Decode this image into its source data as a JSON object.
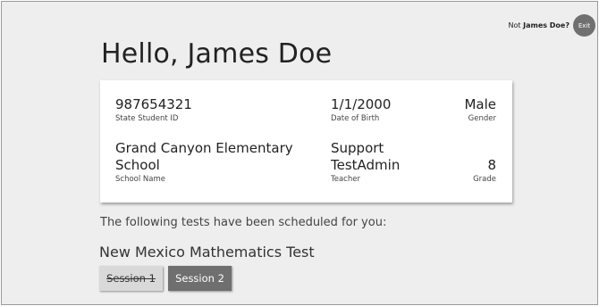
{
  "header": {
    "not_prefix": "Not ",
    "user_name_q": "James Doe?",
    "exit_label": "Exit"
  },
  "greeting": "Hello, James Doe",
  "student": {
    "id_value": "987654321",
    "id_label": "State Student ID",
    "dob_value": "1/1/2000",
    "dob_label": "Date of Birth",
    "gender_value": "Male",
    "gender_label": "Gender",
    "school_line1": "Grand Canyon Elementary",
    "school_line2": "School",
    "school_label": "School Name",
    "teacher_line1": "Support",
    "teacher_line2": "TestAdmin",
    "teacher_label": "Teacher",
    "grade_value": "8",
    "grade_label": "Grade"
  },
  "scheduled_text": "The following tests have been scheduled for you:",
  "test": {
    "name": "New Mexico Mathematics Test",
    "sessions": [
      {
        "label": "Session 1",
        "status": "completed"
      },
      {
        "label": "Session 2",
        "status": "available"
      }
    ]
  }
}
